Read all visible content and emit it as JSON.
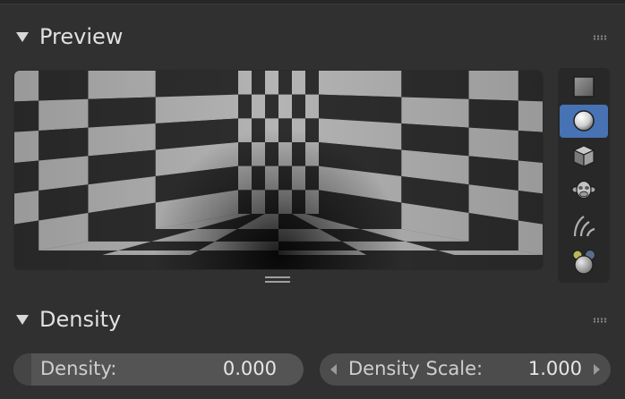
{
  "panels": {
    "preview": {
      "title": "Preview"
    },
    "density": {
      "title": "Density"
    }
  },
  "preview_shapes": [
    {
      "name": "flat-icon",
      "active": false
    },
    {
      "name": "sphere-icon",
      "active": true
    },
    {
      "name": "cube-icon",
      "active": false
    },
    {
      "name": "monkey-icon",
      "active": false
    },
    {
      "name": "hair-icon",
      "active": false
    },
    {
      "name": "world-icon",
      "active": false
    }
  ],
  "fields": {
    "density": {
      "label": "Density:",
      "value": "0.000"
    },
    "density_scale": {
      "label": "Density Scale:",
      "value": "1.000"
    }
  },
  "colors": {
    "accent": "#4772b3",
    "background": "#303030",
    "checker_light": "#b4b4b4",
    "checker_dark": "#2e2e2e"
  }
}
